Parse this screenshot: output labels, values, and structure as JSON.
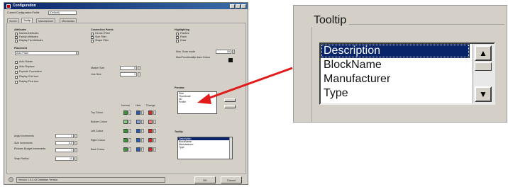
{
  "window": {
    "title": "Configuration"
  },
  "top": {
    "profile_label": "Current Configuration Profile",
    "profile_value": "(Default)"
  },
  "tabs": [
    "Screen",
    "Tooltip",
    "Manufacturer",
    "Mechanism"
  ],
  "attributes": {
    "header": "Attributes",
    "items": [
      "Names Attributes",
      "Family Attributes",
      "Display Tip Attributes"
    ]
  },
  "placement": {
    "header": "Placement",
    "value": "Auto Place"
  },
  "checks": [
    "Auto Rotate",
    "Auto Replace",
    "Explode Connection",
    "Display Grid Icon",
    "Display Pick Icon"
  ],
  "connection_points": {
    "header": "Connection Points",
    "items": [
      "Gender Filter",
      "Size Filter",
      "Shape Filter"
    ]
  },
  "marker": {
    "size_label": "Marker Size",
    "size_value": "6",
    "line_label": "Line Size",
    "line_value": "1"
  },
  "colors": {
    "headers": [
      "Normal",
      "Hide",
      "Change"
    ],
    "rows": [
      "Top Colour",
      "Bottom Colour",
      "Left Colour",
      "Right Colour",
      "Back Colour"
    ],
    "normal": [
      "#2ca02c",
      "#7fd67f",
      "#2ca02c",
      "#2ca02c",
      "#2ca02c"
    ],
    "hide": [
      "#1f5fbf",
      "#7fa8e8",
      "#1f5fbf",
      "#1f5fbf",
      "#1f5fbf"
    ],
    "change": [
      "#d62728",
      "#f08080",
      "#d62728",
      "#d62728",
      "#d62728"
    ]
  },
  "numbers": [
    {
      "label": "Angle Increments",
      "value": "1"
    },
    {
      "label": "Size Increments",
      "value": "5.0"
    },
    {
      "label": "Pictures Budget Increments",
      "value": "1"
    },
    {
      "label": "Snap Radius",
      "value": "10"
    }
  ],
  "highlighting": {
    "header": "Highlighting",
    "items": [
      "Flashes",
      "Flash",
      "Draw"
    ],
    "scan_label": "Max. Scan mode",
    "scan_value": "50",
    "colour_label": "Max/Functionality draw Colour"
  },
  "preview": {
    "header": "Preview",
    "items": [
      "Side",
      "Thumbnail",
      "3D",
      "Profile"
    ]
  },
  "tooltip_small": {
    "header": "Tooltip",
    "items": [
      "Description",
      "BlockName",
      "Manufacturer",
      "Type"
    ]
  },
  "status": {
    "text": "Version 1.5.2.43 Database Version"
  },
  "buttons": {
    "ok": "OK",
    "cancel": "Cancel"
  },
  "zoom": {
    "legend": "Tooltip",
    "items": [
      "Description",
      "BlockName",
      "Manufacturer",
      "Type"
    ],
    "selected": "Description"
  },
  "annotation": {
    "arrow_color": "#e11b1b"
  }
}
